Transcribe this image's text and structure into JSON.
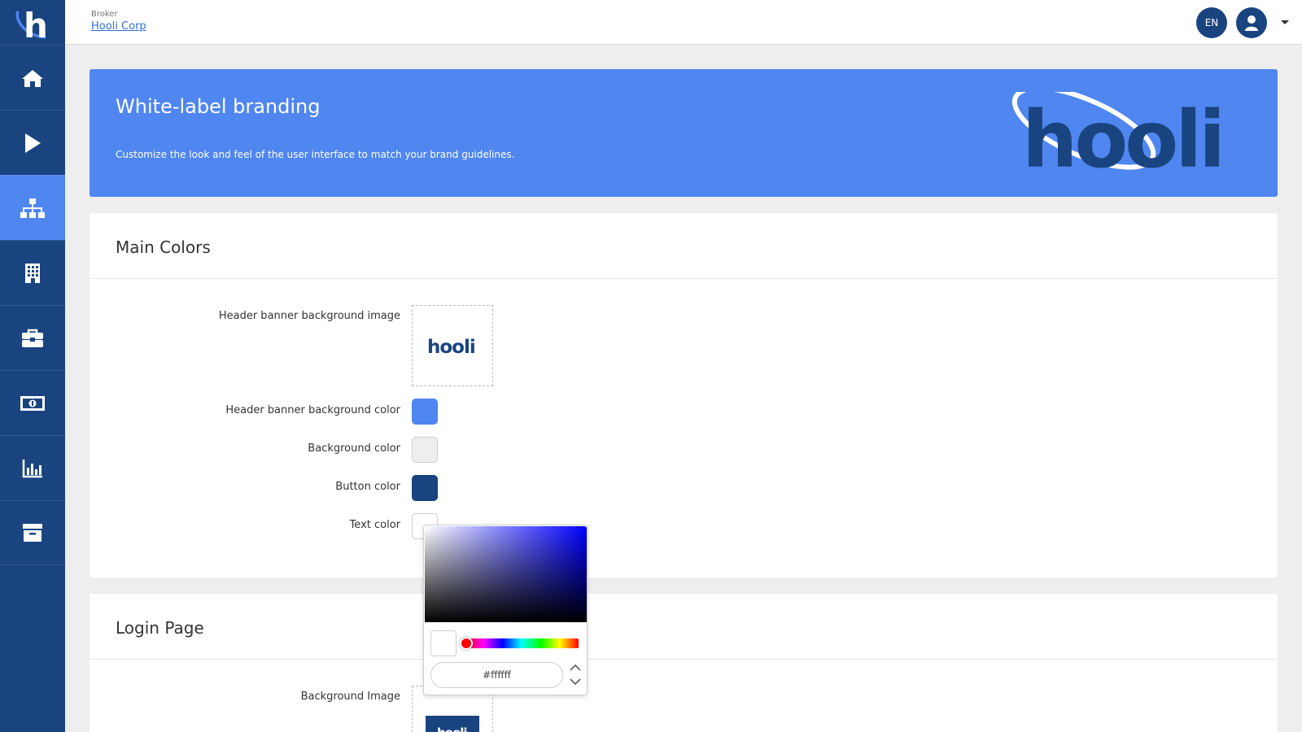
{
  "app": {
    "logo_letter": "h"
  },
  "header": {
    "broker_label": "Broker",
    "broker_name": "Hooli Corp",
    "language": "EN"
  },
  "sidebar": {
    "items": [
      {
        "icon": "home-icon",
        "active": false
      },
      {
        "icon": "play-icon",
        "active": false
      },
      {
        "icon": "sitemap-icon",
        "active": true
      },
      {
        "icon": "building-icon",
        "active": false
      },
      {
        "icon": "briefcase-icon",
        "active": false
      },
      {
        "icon": "money-icon",
        "active": false
      },
      {
        "icon": "chart-icon",
        "active": false
      },
      {
        "icon": "archive-icon",
        "active": false
      }
    ]
  },
  "banner": {
    "title": "White-label branding",
    "subtitle": "Customize the look and feel of the user interface to match your brand guidelines.",
    "logo_text": "hooli"
  },
  "main_colors": {
    "title": "Main Colors",
    "fields": {
      "header_image_label": "Header banner background image",
      "header_image_logo_text": "hooli",
      "header_color_label": "Header banner background color",
      "header_color": "#4f86f0",
      "background_color_label": "Background color",
      "background_color": "#eeeeee",
      "button_color_label": "Button color",
      "button_color": "#1a4480",
      "text_color_label": "Text color",
      "text_color": "#ffffff"
    }
  },
  "login_page": {
    "title": "Login Page",
    "background_image_label": "Background Image",
    "background_image_logo_text": "hooli"
  },
  "color_picker": {
    "hex_value": "#ffffff",
    "hue": 0
  },
  "colors": {
    "sidebar": "#1a4480",
    "accent": "#4f86f0",
    "link": "#2f6fde"
  }
}
